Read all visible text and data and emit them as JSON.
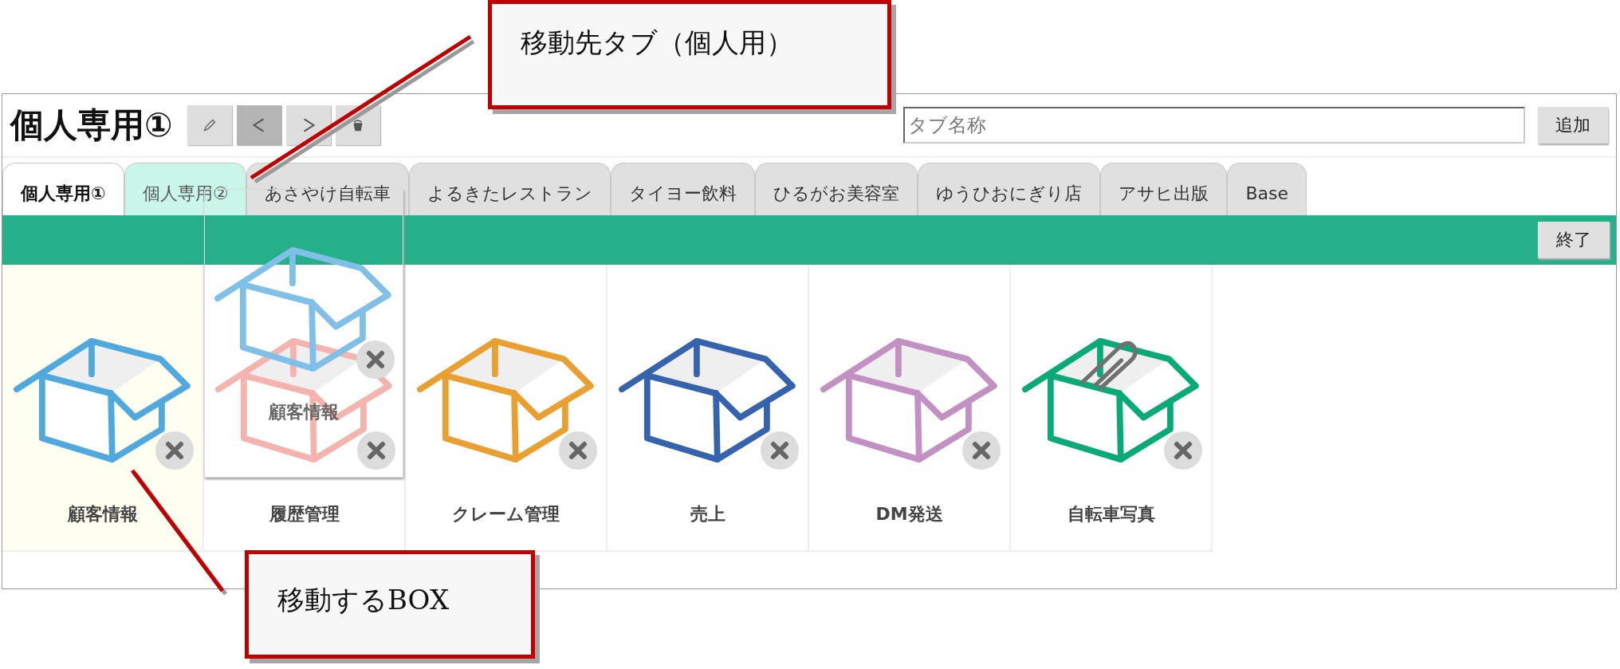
{
  "header": {
    "title": "個人専用①",
    "tool_buttons": [
      {
        "kind": "edit",
        "pressed": false
      },
      {
        "kind": "prev",
        "pressed": true
      },
      {
        "kind": "next",
        "pressed": false
      },
      {
        "kind": "trash",
        "pressed": false
      }
    ],
    "tab_name_field": {
      "placeholder": "タブ名称"
    },
    "add_button": "追加"
  },
  "tabs": [
    {
      "label": "個人専用①",
      "selected": true,
      "highlighted": false
    },
    {
      "label": "個人専用②",
      "selected": false,
      "highlighted": true
    },
    {
      "label": "あさやけ自転車",
      "selected": false,
      "highlighted": false
    },
    {
      "label": "よるきたレストラン",
      "selected": false,
      "highlighted": false
    },
    {
      "label": "タイヨー飲料",
      "selected": false,
      "highlighted": false
    },
    {
      "label": "ひるがお美容室",
      "selected": false,
      "highlighted": false
    },
    {
      "label": "ゆうひおにぎり店",
      "selected": false,
      "highlighted": false
    },
    {
      "label": "アサヒ出版",
      "selected": false,
      "highlighted": false
    },
    {
      "label": "Base",
      "selected": false,
      "highlighted": false
    }
  ],
  "end_button": "終了",
  "boxes": [
    {
      "label": "顧客情報",
      "color": "#4fa8de",
      "kind": "plain",
      "moving": true
    },
    {
      "label": "履歴管理",
      "color": "#f5b3ad",
      "kind": "plain",
      "moving": false
    },
    {
      "label": "クレーム管理",
      "color": "#e9a030",
      "kind": "plain",
      "moving": false
    },
    {
      "label": "売上",
      "color": "#3563ad",
      "kind": "plain",
      "moving": false
    },
    {
      "label": "DM発送",
      "color": "#c390c3",
      "kind": "plain",
      "moving": false
    },
    {
      "label": "自転車写真",
      "color": "#0aa978",
      "kind": "clip",
      "moving": false
    }
  ],
  "drag_ghost": {
    "label": "顧客情報",
    "color": "#80c0e8"
  },
  "callouts": [
    {
      "text": "移動先タブ（個人用）"
    },
    {
      "text": "移動するBOX"
    }
  ]
}
